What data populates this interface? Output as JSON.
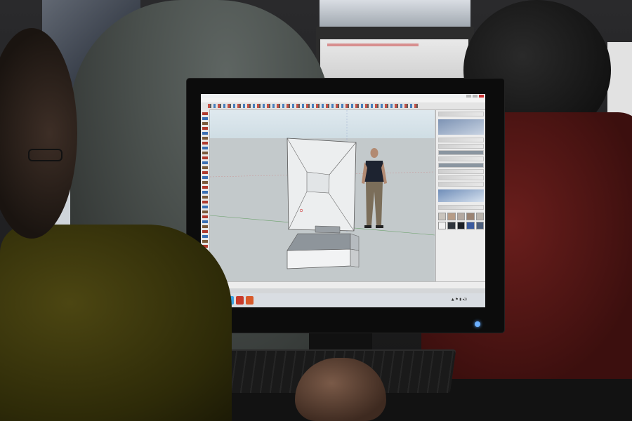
{
  "scene": {
    "description_label": "",
    "screen": {
      "window_title": "",
      "menu_items": [],
      "status_text": "",
      "taskbar": {
        "time": "",
        "date": ""
      },
      "tray_header": "",
      "material_swatches": [
        "#c9c4bd",
        "#b69c87",
        "#b3a8a0",
        "#9a8373",
        "#bab4ad",
        "#f1f1f1",
        "#2f343b",
        "#1b1f25",
        "#3a5a9e",
        "#4d5f7c"
      ]
    },
    "monitor_brand": "",
    "model": {
      "object": "cabinet-box",
      "figure": "scale-figure-person"
    },
    "colors": {
      "accent_power_led": "#6cb0ff",
      "taskbar": "#d9dde2",
      "viewport_ground": "#c3c9cb",
      "viewport_sky": "#dfe9ef"
    }
  }
}
